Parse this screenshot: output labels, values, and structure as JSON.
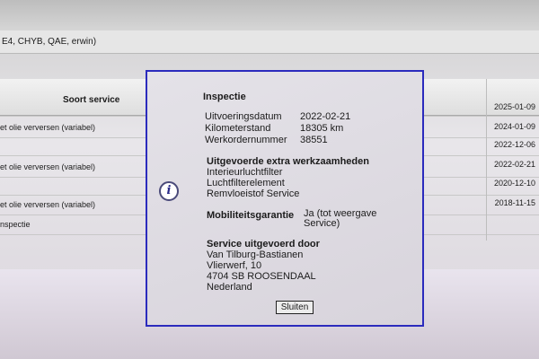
{
  "header": {
    "users_text": "E4, CHYB, QAE, erwin)"
  },
  "table": {
    "col_soort_service": "Soort service",
    "rows": [
      {
        "service": "",
        "date": "2025-01-09"
      },
      {
        "service": "et olie verversen (variabel)",
        "date": "2024-01-09"
      },
      {
        "service": "",
        "date": "2022-12-06"
      },
      {
        "service": "et olie verversen (variabel)",
        "date": "2022-02-21"
      },
      {
        "service": "",
        "date": "2020-12-10"
      },
      {
        "service": "et olie verversen (variabel)",
        "date": "2018-11-15"
      },
      {
        "service": "nspectie",
        "date": ""
      }
    ]
  },
  "dialog": {
    "title": "Inspectie",
    "fields": [
      {
        "label": "Uitvoeringsdatum",
        "value": "2022-02-21"
      },
      {
        "label": "Kilometerstand",
        "value": "18305 km"
      },
      {
        "label": "Werkordernummer",
        "value": "38551"
      }
    ],
    "extra_heading": "Uitgevoerde extra werkzaamheden",
    "extra_items": [
      "Interieurluchtfilter",
      "Luchtfilterelement",
      "Remvloeistof Service"
    ],
    "mobiliteit_label": "Mobiliteitsgarantie",
    "mobiliteit_value_1": "Ja (tot weergave",
    "mobiliteit_value_2": "Service)",
    "service_heading": "Service uitgevoerd door",
    "address": [
      "Van Tilburg-Bastianen",
      "Vlierwerf, 10",
      "4704 SB ROOSENDAAL",
      "Nederland"
    ],
    "close_label": "Sluiten",
    "icon": "info-icon"
  }
}
